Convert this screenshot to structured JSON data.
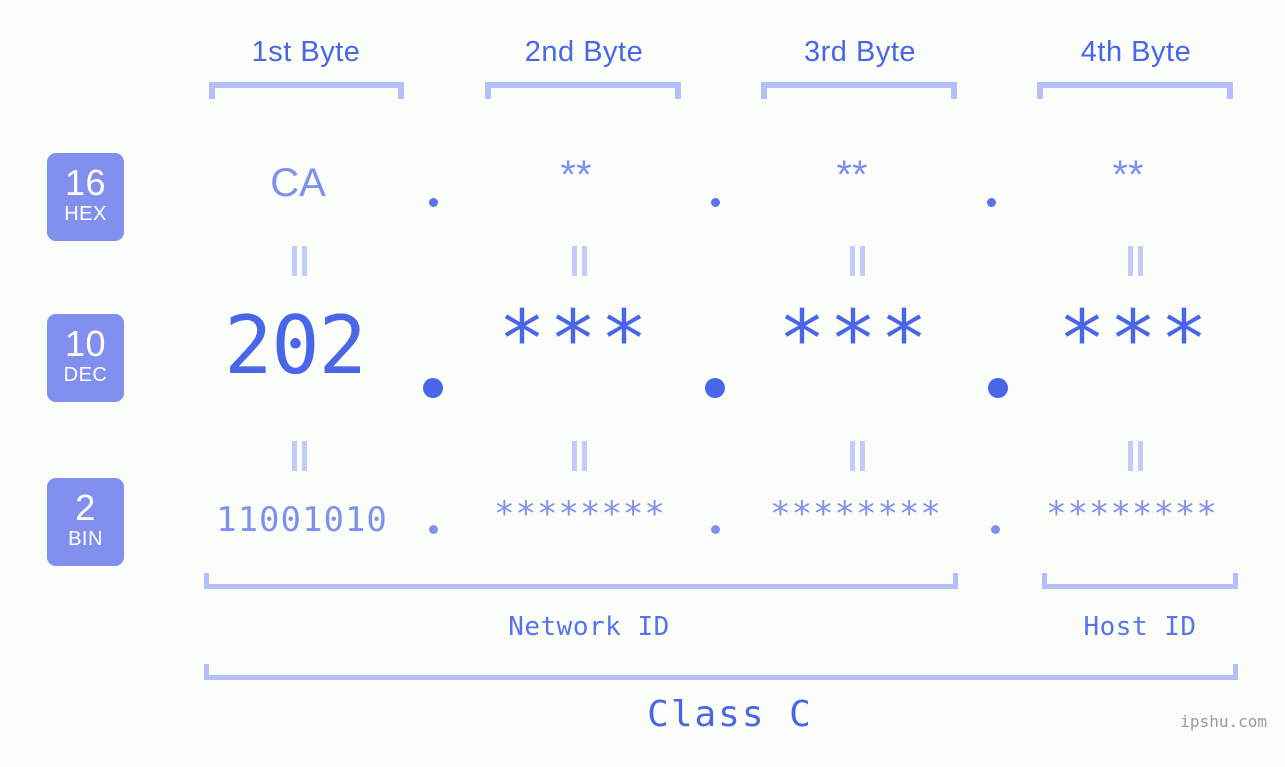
{
  "meta": {
    "background_color": "#fbfdf8",
    "accent_color": "#4a66e8",
    "accent_light_color": "#8190ef",
    "bracket_color": "#b5bffa",
    "badge_color": "#8190ef",
    "watermark": "ipshu.com"
  },
  "headers": [
    {
      "label": "1st Byte"
    },
    {
      "label": "2nd Byte"
    },
    {
      "label": "3rd Byte"
    },
    {
      "label": "4th Byte"
    }
  ],
  "bases": [
    {
      "number": "16",
      "name": "HEX"
    },
    {
      "number": "10",
      "name": "DEC"
    },
    {
      "number": "2",
      "name": "BIN"
    }
  ],
  "rows": {
    "hex": {
      "base_number": "16",
      "base_name": "HEX",
      "values": [
        "CA",
        "**",
        "**",
        "**"
      ],
      "separator": "."
    },
    "dec": {
      "base_number": "10",
      "base_name": "DEC",
      "values": [
        "202",
        "***",
        "***",
        "***"
      ],
      "separator": "."
    },
    "bin": {
      "base_number": "2",
      "base_name": "BIN",
      "values": [
        "11001010",
        "********",
        "********",
        "********"
      ],
      "separator": "."
    }
  },
  "equivalence_markers": {
    "symbol": "||",
    "count_per_gap": 4
  },
  "footer": {
    "network_id_label": "Network ID",
    "host_id_label": "Host ID",
    "class_label": "Class C"
  }
}
